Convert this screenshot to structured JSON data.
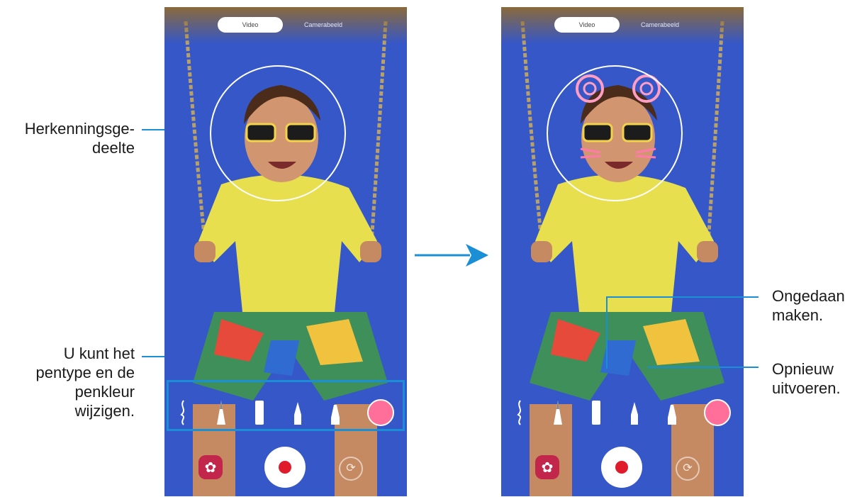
{
  "screens": [
    {
      "mode_tabs": [
        "Video",
        "Camerabeeld"
      ],
      "shutter": "record"
    },
    {
      "mode_tabs": [
        "Video",
        "Camerabeeld"
      ],
      "shutter": "record"
    }
  ],
  "callouts": {
    "recognition_area": "Herkenningsge-\ndeelte",
    "pen_options": "U kunt het\npentype en de\npenkleur\nwijzigen.",
    "undo": "Ongedaan\nmaken.",
    "redo": "Opnieuw\nuitvoeren."
  },
  "colors": {
    "callout_line": "#1a8fd6",
    "background_blue": "#3557c8",
    "pen_color": "#ff6f9a",
    "record_dot": "#e01c2c",
    "stickers_button": "#c2264a"
  },
  "icons": {
    "arrow": "right-arrow-icon",
    "stickers": "flower-icon",
    "switch_camera": "switch-camera-icon"
  }
}
